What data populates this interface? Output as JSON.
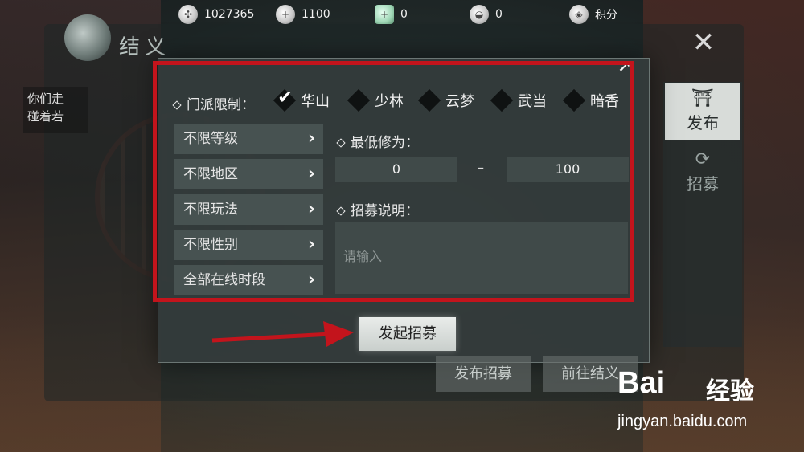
{
  "topbar": {
    "items": [
      {
        "icon": "film-reel-icon",
        "value": "1027365"
      },
      {
        "icon": "silver-ingot-plus-icon",
        "value": "1100"
      },
      {
        "icon": "jade-ticket-icon",
        "value": "0"
      },
      {
        "icon": "gold-ingot-icon",
        "value": "0"
      },
      {
        "icon": "shield-badge-icon",
        "value": "积分"
      }
    ]
  },
  "header": {
    "title": "结义"
  },
  "chat": {
    "text": "你们走\n碰着若"
  },
  "side_tabs": {
    "publish": "发布",
    "recruit": "招募"
  },
  "dialog": {
    "school_label": "门派限制：",
    "schools": [
      {
        "name": "华山",
        "checked": true
      },
      {
        "name": "少林",
        "checked": false
      },
      {
        "name": "云梦",
        "checked": false
      },
      {
        "name": "武当",
        "checked": false
      },
      {
        "name": "暗香",
        "checked": false
      }
    ],
    "filters": [
      "不限等级",
      "不限地区",
      "不限玩法",
      "不限性别",
      "全部在线时段"
    ],
    "min_cultivation_label": "最低修为：",
    "min_value": "0",
    "range_dash": "–",
    "max_value": "100",
    "description_label": "招募说明：",
    "description_placeholder": "请输入",
    "launch_button": "发起招募"
  },
  "bottom_buttons": {
    "publish": "发布招募",
    "go": "前往结义"
  },
  "watermark": {
    "logo": "Bai",
    "text": "经验",
    "url": "jingyan.baidu.com"
  },
  "colors": {
    "highlight": "#c3141c",
    "arrow": "#c3141c"
  }
}
